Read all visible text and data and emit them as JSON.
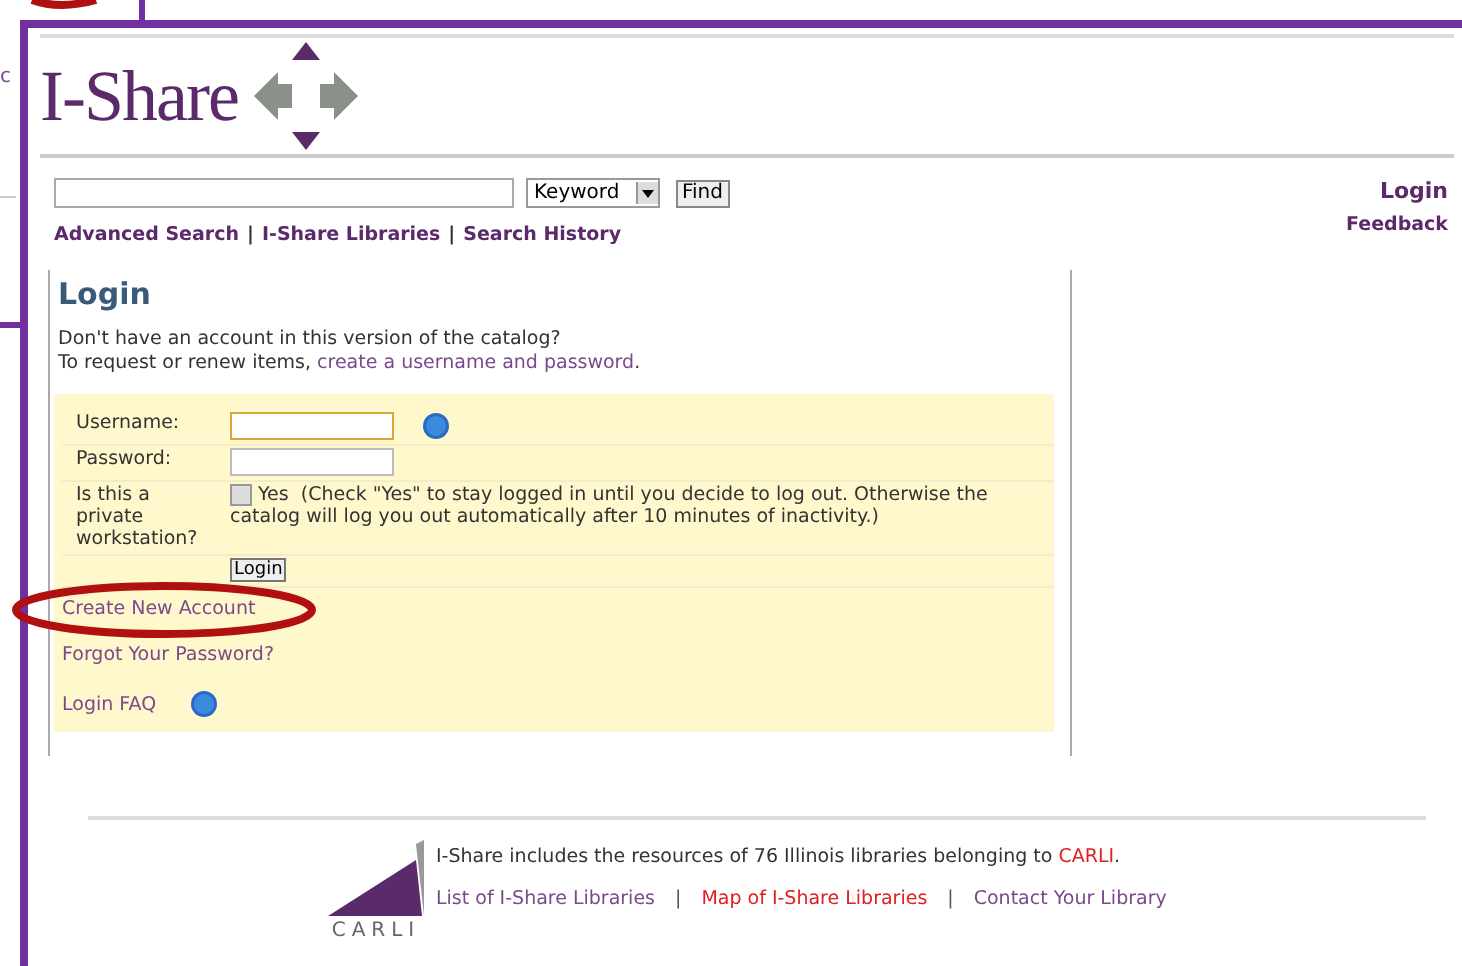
{
  "background_fragment": {
    "text": "c"
  },
  "header": {
    "logo_text": "I-Share"
  },
  "search": {
    "scope": "Keyword",
    "button": "Find"
  },
  "search_links": [
    {
      "kind": "link",
      "text": "Advanced Search"
    },
    {
      "kind": "separator",
      "text": "|"
    },
    {
      "kind": "link",
      "text": "I-Share Libraries"
    },
    {
      "kind": "separator",
      "text": "|"
    },
    {
      "kind": "link",
      "text": "Search History"
    }
  ],
  "account_links": [
    "Login",
    "Feedback"
  ],
  "login": {
    "title": "Login",
    "intro": "Don't have an account in this version of the catalog?",
    "request_text": "To request or renew items, ",
    "request_link": "create a username and password",
    "request_end": "."
  },
  "form": {
    "username": {
      "label": "Username:",
      "focused": true
    },
    "password": {
      "label": "Password:"
    },
    "private": {
      "label": "Is this a private workstation?",
      "checked": false,
      "option": "Yes",
      "note": "(Check \"Yes\" to stay logged in until you decide to log out. Otherwise the catalog will log you out automatically after 10 minutes of inactivity.)"
    },
    "button": "Login",
    "links": [
      {
        "kind": "link",
        "text": "Create New Account"
      },
      {
        "kind": "link",
        "text": "Forgot Your Password?"
      },
      {
        "kind": "help",
        "text": "Login FAQ"
      }
    ]
  },
  "footer": {
    "text": "I-Share includes the resources of 76 Illinois libraries belonging to ",
    "text_link": "CARLI",
    "text_end": ".",
    "logo_text": "CARLI",
    "links": [
      {
        "kind": "link",
        "text": "List of I-Share Libraries",
        "color": "#7a4a8a"
      },
      {
        "kind": "separator",
        "text": "|",
        "color": "#555555"
      },
      {
        "kind": "link",
        "text": "Map of I-Share Libraries",
        "color": "#e02020"
      },
      {
        "kind": "separator",
        "text": "|",
        "color": "#555555"
      },
      {
        "kind": "link",
        "text": "Contact Your Library",
        "color": "#7a4a8a"
      }
    ]
  }
}
